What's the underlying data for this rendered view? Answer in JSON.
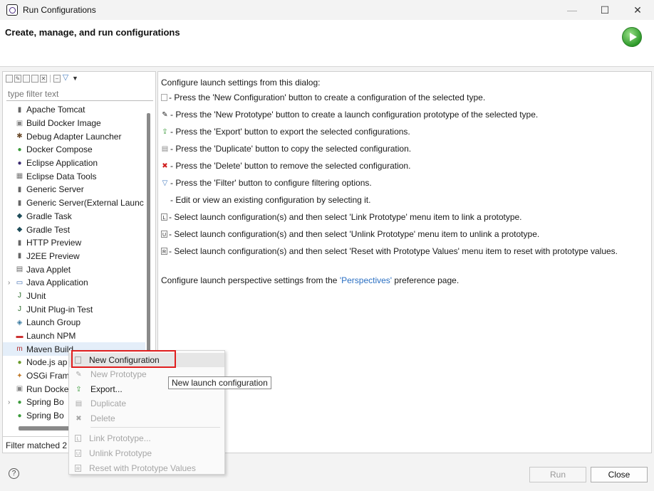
{
  "window": {
    "title": "Run Configurations"
  },
  "header": {
    "title": "Create, manage, and run configurations"
  },
  "left": {
    "filter_placeholder": "type filter text",
    "items": [
      {
        "label": "Apache Tomcat",
        "icon": "server-icon",
        "expander": ""
      },
      {
        "label": "Build Docker Image",
        "icon": "docker-icon",
        "expander": ""
      },
      {
        "label": "Debug Adapter Launcher",
        "icon": "bug-icon",
        "expander": ""
      },
      {
        "label": "Docker Compose",
        "icon": "compose-icon",
        "expander": ""
      },
      {
        "label": "Eclipse Application",
        "icon": "eclipse-icon",
        "expander": ""
      },
      {
        "label": "Eclipse Data Tools",
        "icon": "database-icon",
        "expander": ""
      },
      {
        "label": "Generic Server",
        "icon": "server-icon",
        "expander": ""
      },
      {
        "label": "Generic Server(External Launc",
        "icon": "server-icon",
        "expander": ""
      },
      {
        "label": "Gradle Task",
        "icon": "gradle-icon",
        "expander": ""
      },
      {
        "label": "Gradle Test",
        "icon": "gradle-icon",
        "expander": ""
      },
      {
        "label": "HTTP Preview",
        "icon": "server-icon",
        "expander": ""
      },
      {
        "label": "J2EE Preview",
        "icon": "server-icon",
        "expander": ""
      },
      {
        "label": "Java Applet",
        "icon": "applet-icon",
        "expander": ""
      },
      {
        "label": "Java Application",
        "icon": "java-app-icon",
        "expander": "›"
      },
      {
        "label": "JUnit",
        "icon": "junit-icon",
        "expander": ""
      },
      {
        "label": "JUnit Plug-in Test",
        "icon": "junit-icon",
        "expander": ""
      },
      {
        "label": "Launch Group",
        "icon": "group-icon",
        "expander": ""
      },
      {
        "label": "Launch NPM",
        "icon": "npm-icon",
        "expander": ""
      },
      {
        "label": "Maven Build",
        "icon": "maven-icon",
        "expander": ""
      },
      {
        "label": "Node.js ap",
        "icon": "nodejs-icon",
        "expander": ""
      },
      {
        "label": "OSGi Fram",
        "icon": "osgi-icon",
        "expander": ""
      },
      {
        "label": "Run Docke",
        "icon": "docker-icon",
        "expander": ""
      },
      {
        "label": "Spring Bo",
        "icon": "spring-icon",
        "expander": "›"
      },
      {
        "label": "Spring Bo",
        "icon": "spring-icon",
        "expander": ""
      }
    ],
    "status": "Filter matched 2"
  },
  "right": {
    "intro": "Configure launch settings from this dialog:",
    "lines": [
      "- Press the 'New Configuration' button to create a configuration of the selected type.",
      "- Press the 'New Prototype' button to create a launch configuration prototype of the selected type.",
      "- Press the 'Export' button to export the selected configurations.",
      "- Press the 'Duplicate' button to copy the selected configuration.",
      "- Press the 'Delete' button to remove the selected configuration.",
      "- Press the 'Filter' button to configure filtering options.",
      "- Edit or view an existing configuration by selecting it.",
      "- Select launch configuration(s) and then select 'Link Prototype' menu item to link a prototype.",
      "- Select launch configuration(s) and then select 'Unlink Prototype' menu item to unlink a prototype.",
      "- Select launch configuration(s) and then select 'Reset with Prototype Values' menu item to reset with prototype values."
    ],
    "footer_pre": "Configure launch perspective settings from the ",
    "footer_link": "'Perspectives'",
    "footer_post": " preference page."
  },
  "context_menu": {
    "new_configuration": "New Configuration",
    "new_prototype": "New Prototype",
    "export": "Export...",
    "duplicate": "Duplicate",
    "delete": "Delete",
    "link_prototype": "Link Prototype...",
    "unlink_prototype": "Unlink Prototype",
    "reset_prototype": "Reset with Prototype Values"
  },
  "tooltip": "New launch configuration",
  "buttons": {
    "run": "Run",
    "close": "Close"
  },
  "colors": {
    "accent_link": "#2a6fc2",
    "highlight_box": "#e01e1e",
    "run_green": "#2e9a2a"
  }
}
